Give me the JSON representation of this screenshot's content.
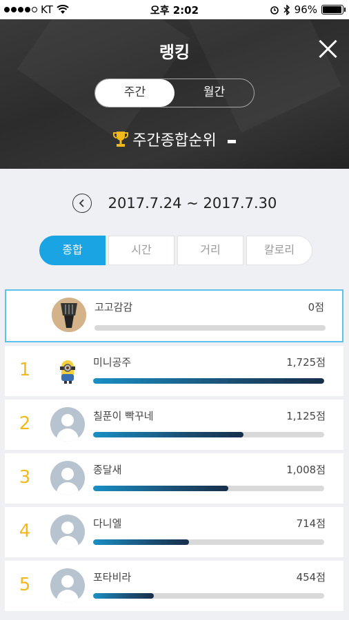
{
  "status_bar": {
    "carrier": "KT",
    "time": "오후 2:02",
    "battery": "96%",
    "battery_level": 0.96
  },
  "header": {
    "title": "랭킹",
    "tabs": [
      {
        "label": "주간",
        "active": true
      },
      {
        "label": "월간",
        "active": false
      }
    ],
    "ranking_type": "주간종합순위"
  },
  "date_nav": {
    "range": "2017.7.24 ~ 2017.7.30"
  },
  "category_tabs": [
    {
      "label": "종합",
      "active": true
    },
    {
      "label": "시간",
      "active": false
    },
    {
      "label": "거리",
      "active": false
    },
    {
      "label": "칼로리",
      "active": false
    }
  ],
  "my_ranking": {
    "name": "고고감감",
    "score": "0점",
    "progress": 0
  },
  "rankings": [
    {
      "rank": "1",
      "name": "미니공주",
      "score": "1,725점",
      "progress": 1.0,
      "avatar": "minion"
    },
    {
      "rank": "2",
      "name": "칠푼이 빡꾸네",
      "score": "1,125점",
      "progress": 0.652,
      "avatar": "default"
    },
    {
      "rank": "3",
      "name": "종달새",
      "score": "1,008점",
      "progress": 0.584,
      "avatar": "default"
    },
    {
      "rank": "4",
      "name": "다니엘",
      "score": "714점",
      "progress": 0.414,
      "avatar": "default"
    },
    {
      "rank": "5",
      "name": "포타비라",
      "score": "454점",
      "progress": 0.263,
      "avatar": "default"
    }
  ],
  "colors": {
    "accent": "#1ba4e4",
    "rank_number": "#f2b81c",
    "bar_dark": "#172f4b"
  }
}
